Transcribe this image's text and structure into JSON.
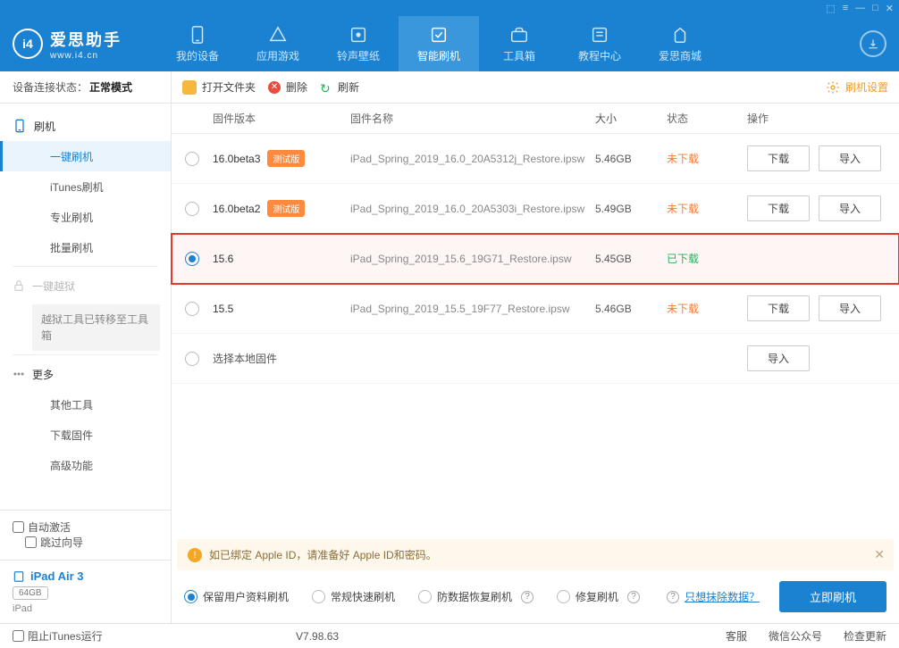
{
  "window_controls": [
    "⬚",
    "≡",
    "—",
    "□",
    "✕"
  ],
  "logo": {
    "title": "爱思助手",
    "subtitle": "www.i4.cn"
  },
  "nav": [
    {
      "label": "我的设备",
      "active": false
    },
    {
      "label": "应用游戏",
      "active": false
    },
    {
      "label": "铃声壁纸",
      "active": false
    },
    {
      "label": "智能刷机",
      "active": true
    },
    {
      "label": "工具箱",
      "active": false
    },
    {
      "label": "教程中心",
      "active": false
    },
    {
      "label": "爱思商城",
      "active": false
    }
  ],
  "sidebar": {
    "status_label": "设备连接状态：",
    "status_value": "正常模式",
    "flash_group": "刷机",
    "items": [
      "一键刷机",
      "iTunes刷机",
      "专业刷机",
      "批量刷机"
    ],
    "jailbreak": "一键越狱",
    "jailbreak_note": "越狱工具已转移至工具箱",
    "more_group": "更多",
    "more_items": [
      "其他工具",
      "下载固件",
      "高级功能"
    ],
    "auto_activate": "自动激活",
    "skip_guide": "跳过向导",
    "device_name": "iPad Air 3",
    "device_capacity": "64GB",
    "device_kind": "iPad"
  },
  "toolbar": {
    "open": "打开文件夹",
    "delete": "删除",
    "refresh": "刷新",
    "settings": "刷机设置"
  },
  "columns": {
    "ver": "固件版本",
    "name": "固件名称",
    "size": "大小",
    "status": "状态",
    "actions": "操作"
  },
  "rows": [
    {
      "ver": "16.0beta3",
      "beta": true,
      "name": "iPad_Spring_2019_16.0_20A5312j_Restore.ipsw",
      "size": "5.46GB",
      "status": "未下载",
      "downloaded": false,
      "selected": false,
      "has_actions": true
    },
    {
      "ver": "16.0beta2",
      "beta": true,
      "name": "iPad_Spring_2019_16.0_20A5303i_Restore.ipsw",
      "size": "5.49GB",
      "status": "未下载",
      "downloaded": false,
      "selected": false,
      "has_actions": true
    },
    {
      "ver": "15.6",
      "beta": false,
      "name": "iPad_Spring_2019_15.6_19G71_Restore.ipsw",
      "size": "5.45GB",
      "status": "已下载",
      "downloaded": true,
      "selected": true,
      "has_actions": false
    },
    {
      "ver": "15.5",
      "beta": false,
      "name": "iPad_Spring_2019_15.5_19F77_Restore.ipsw",
      "size": "5.46GB",
      "status": "未下载",
      "downloaded": false,
      "selected": false,
      "has_actions": true
    }
  ],
  "local_row": "选择本地固件",
  "buttons": {
    "download": "下载",
    "import": "导入"
  },
  "tip": "如已绑定 Apple ID，请准备好 Apple ID和密码。",
  "options": [
    "保留用户资料刷机",
    "常规快速刷机",
    "防数据恢复刷机",
    "修复刷机"
  ],
  "only_erase": "只想抹除数据？",
  "flash_now": "立即刷机",
  "footer": {
    "block_itunes": "阻止iTunes运行",
    "version": "V7.98.63",
    "links": [
      "客服",
      "微信公众号",
      "检查更新"
    ]
  }
}
